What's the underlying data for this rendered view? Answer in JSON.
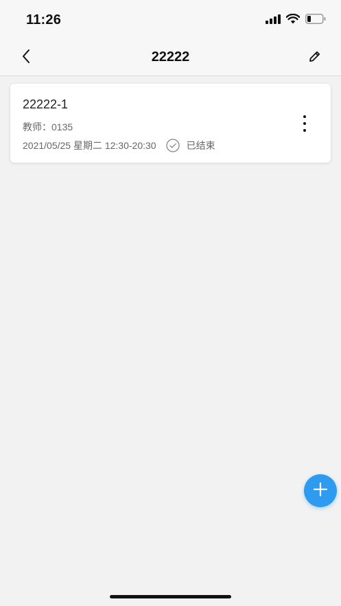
{
  "status_bar": {
    "time": "11:26",
    "icons": [
      "cellular-signal-icon",
      "wifi-icon",
      "battery-icon"
    ]
  },
  "nav": {
    "title": "22222",
    "back_icon": "chevron-left-icon",
    "edit_icon": "pencil-icon"
  },
  "lessons": [
    {
      "title": "22222-1",
      "teacher": "教师：0135",
      "datetime": "2021/05/25 星期二 12:30-20:30",
      "status": "已结束",
      "status_icon": "check-circle-icon",
      "menu_icon": "more-vertical-icon"
    }
  ],
  "fab": {
    "icon": "plus-icon",
    "color": "#2f9bf0"
  },
  "colors": {
    "background": "#f2f2f2",
    "card": "#ffffff",
    "accent": "#2f9bf0",
    "muted_text": "#666666"
  }
}
